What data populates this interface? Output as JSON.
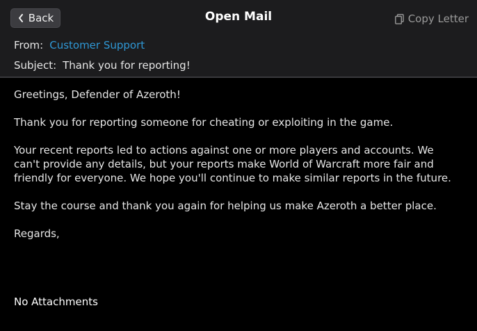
{
  "header": {
    "back_label": "Back",
    "title": "Open Mail",
    "copy_label": "Copy Letter"
  },
  "meta": {
    "from_label": "From:",
    "from_value": "Customer Support",
    "subject_label": "Subject:",
    "subject_value": "Thank you for reporting!"
  },
  "letter": {
    "greeting": "Greetings, Defender of Azeroth!",
    "p1": "Thank you for reporting someone for cheating or exploiting in the game.",
    "p2": "Your recent reports led to actions against one or more players and accounts. We can't provide any details, but your reports make World of Warcraft more fair and friendly for everyone. We hope you'll continue to make similar reports in the future.",
    "p3": "Stay the course and thank you again for helping us make Azeroth a better place.",
    "closing": "Regards,"
  },
  "attachments_label": "No Attachments",
  "colors": {
    "link": "#2f98d6",
    "header_bg": "#1c1c1e",
    "background": "#000000"
  },
  "icons": {
    "back": "chevron-left-icon",
    "copy": "copy-icon"
  }
}
